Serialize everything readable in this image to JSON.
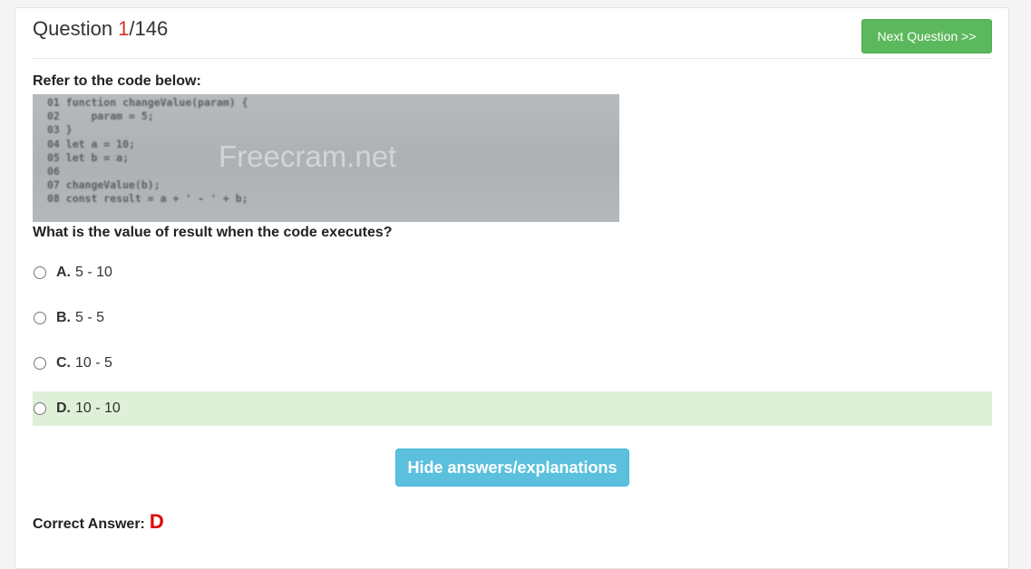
{
  "header": {
    "question_word": "Question ",
    "current": "1",
    "total_sep": "/146",
    "next_label": "Next Question >>"
  },
  "prompt": "Refer to the code below:",
  "code_image": {
    "lines": [
      "01 function changeValue(param) {",
      "02     param = 5;",
      "03 }",
      "04 let a = 10;",
      "05 let b = a;",
      "06",
      "07 changeValue(b);",
      "08 const result = a + ' - ' + b;"
    ],
    "watermark": "Freecram.net"
  },
  "question": "What is the value of result when the code executes?",
  "options": [
    {
      "letter": "A.",
      "text": "5 - 10"
    },
    {
      "letter": "B.",
      "text": "5 - 5"
    },
    {
      "letter": "C.",
      "text": "10 - 5"
    },
    {
      "letter": "D.",
      "text": "10 - 10"
    }
  ],
  "hide_label": "Hide answers/explanations",
  "answer": {
    "label": "Correct Answer:",
    "value": "D"
  },
  "colors": {
    "accent_next": "#5cb85c",
    "accent_hide": "#5bc0de",
    "correct_bg": "#dff0d8",
    "answer_red": "#e00000"
  }
}
